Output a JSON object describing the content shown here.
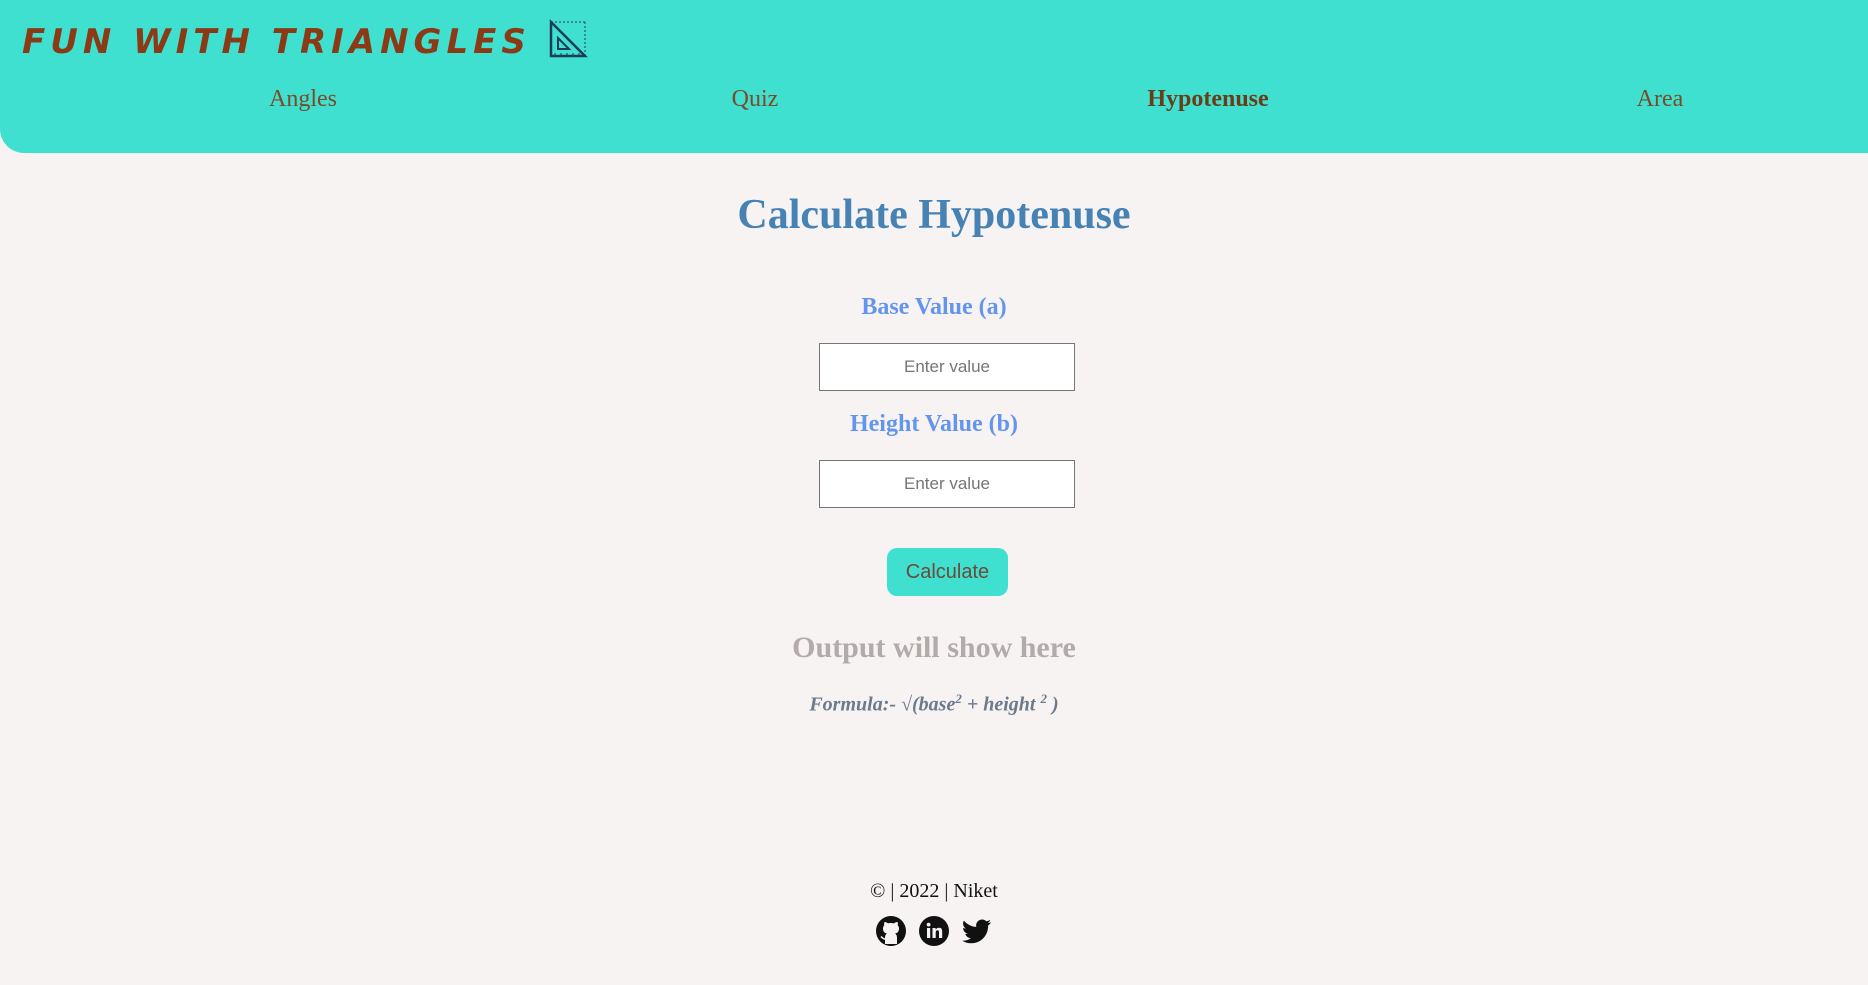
{
  "header": {
    "brand_title": "FUN WITH TRIANGLES",
    "brand_icon": "set-square-icon",
    "nav": [
      {
        "label": "Angles",
        "active": false
      },
      {
        "label": "Quiz",
        "active": false
      },
      {
        "label": "Hypotenuse",
        "active": true
      },
      {
        "label": "Area",
        "active": false
      }
    ]
  },
  "main": {
    "title": "Calculate Hypotenuse",
    "base": {
      "label": "Base Value (a)",
      "placeholder": "Enter value",
      "value": ""
    },
    "height": {
      "label": "Height Value (b)",
      "placeholder": "Enter value",
      "value": ""
    },
    "calculate_label": "Calculate",
    "output": "Output will show here",
    "formula": {
      "prefix": "Formula:- √(base",
      "sup1": "2",
      "mid": " + height ",
      "sup2": "2",
      "suffix": " )"
    }
  },
  "footer": {
    "copyright": "© | 2022 | Niket",
    "socials": [
      "github-icon",
      "linkedin-icon",
      "twitter-icon"
    ]
  },
  "colors": {
    "header_bg": "#40e0d0",
    "brand": "#8b3a16",
    "title": "#4682b4",
    "label": "#6495ed",
    "page_bg": "#f7f3f3"
  }
}
